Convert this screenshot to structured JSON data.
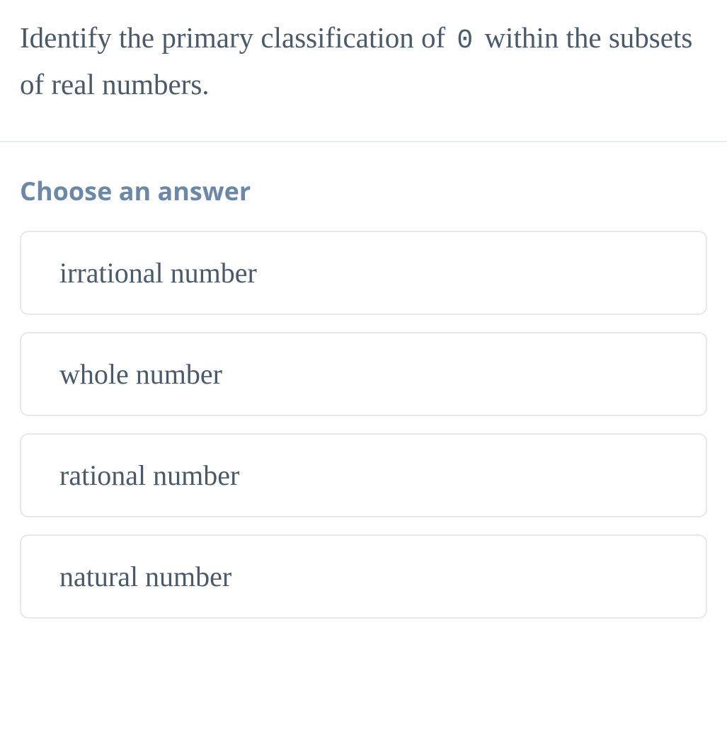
{
  "question": {
    "prefix": "Identify the primary classification of ",
    "number": "0",
    "suffix": " within the subsets of real numbers."
  },
  "prompt": "Choose an answer",
  "options": [
    {
      "label": "irrational number"
    },
    {
      "label": "whole number"
    },
    {
      "label": "rational number"
    },
    {
      "label": "natural number"
    }
  ]
}
